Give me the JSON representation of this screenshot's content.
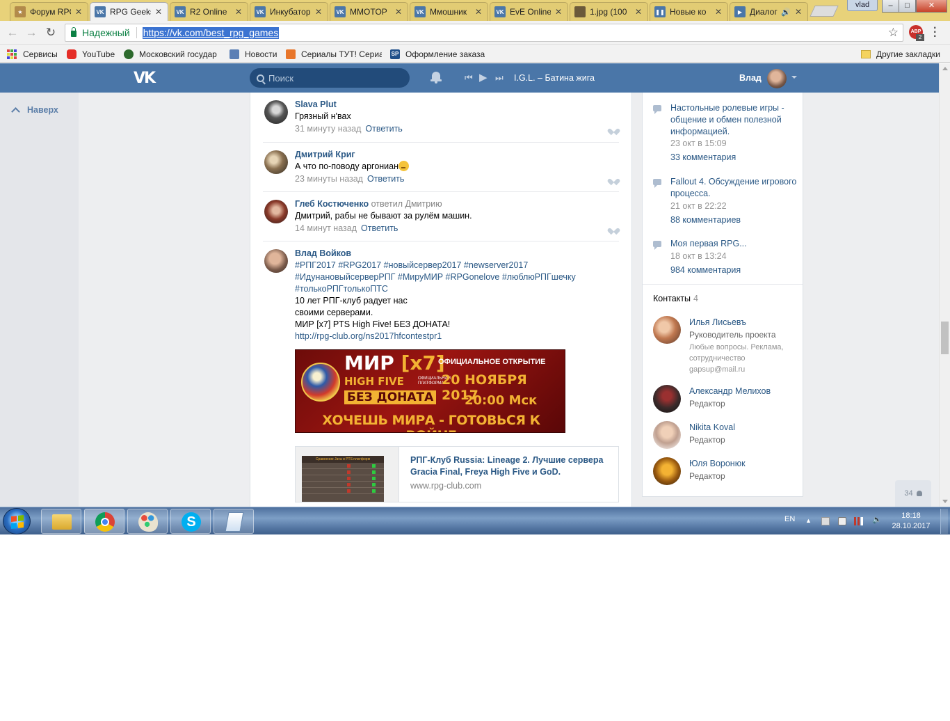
{
  "browser": {
    "window_user": "vlad",
    "tabs": [
      {
        "title": "Форум RPG",
        "icon": "forum-icon",
        "color": "#b28a4a"
      },
      {
        "title": "RPG Geeks",
        "icon": "vk-icon",
        "color": "#4a76a8",
        "active": true
      },
      {
        "title": "R2 Online",
        "icon": "vk-icon",
        "color": "#4a76a8"
      },
      {
        "title": "Инкубатор",
        "icon": "vk-icon",
        "color": "#4a76a8"
      },
      {
        "title": "MMOTOP",
        "icon": "vk-icon",
        "color": "#4a76a8"
      },
      {
        "title": "Ммошник",
        "icon": "vk-icon",
        "color": "#4a76a8"
      },
      {
        "title": "EvE Online",
        "icon": "vk-icon",
        "color": "#4a76a8"
      },
      {
        "title": "1.jpg (100",
        "icon": "image-icon",
        "color": "#6b5a3a"
      },
      {
        "title": "Новые ко",
        "icon": "pause-icon",
        "color": "#4a76a8"
      },
      {
        "title": "Диалог",
        "icon": "vk-video-icon",
        "color": "#4a76a8",
        "audio": true
      }
    ],
    "secure_label": "Надежный",
    "url": "https://vk.com/best_rpg_games",
    "abp_label": "ABP",
    "abp_count": "2",
    "bookmarks": [
      {
        "label": "Сервисы",
        "icon": "apps-icon"
      },
      {
        "label": "YouTube",
        "icon": "youtube-icon",
        "color": "#e52d27"
      },
      {
        "label": "Московский государ",
        "icon": "crest-icon",
        "color": "#2d6a2d"
      },
      {
        "label": "Новости",
        "icon": "news-icon",
        "color": "#5b7fb5"
      },
      {
        "label": "Сериалы ТУТ! Сериа",
        "icon": "serials-icon",
        "color": "#e8762b"
      },
      {
        "label": "Оформление заказа",
        "icon": "sp-icon",
        "color": "#1f4f8a",
        "text": "SP"
      }
    ],
    "other_bookmarks": "Другие закладки"
  },
  "vk": {
    "search_placeholder": "Поиск",
    "now_playing": "I.G.L. – Батина жига",
    "user_name": "Влад",
    "back_to_top": "Наверх",
    "comments": [
      {
        "author": "Slava Plut",
        "text": "Грязный н'вах",
        "time": "31 минуту назад",
        "reply": "Ответить"
      },
      {
        "author": "Дмитрий Криг",
        "text": "А что по-поводу аргониан",
        "time": "23 минуты назад",
        "reply": "Ответить"
      },
      {
        "author": "Глеб Костюченко",
        "reply_to": "ответил Дмитрию",
        "text": "Дмитрий, рабы не бывают за рулём машин.",
        "time": "14 минут назад",
        "reply": "Ответить"
      }
    ],
    "post": {
      "author": "Влад Войков",
      "tags_line1": "#РПГ2017 #RPG2017 #новыйсервер2017 #newserver2017",
      "tags_line2": "#ИдунановыйсерверРПГ #МируМИР #RPGonelove #люблюРПГшечку",
      "tags_line3": "#толькоРПГтолькоПТС",
      "text_line1": "10 лет РПГ-клуб радует нас",
      "text_line2": "своими серверами.",
      "text_line3": "МИР [x7] PTS High Five! БЕЗ ДОНАТА!",
      "link": "http://rpg-club.org/ns2017hfcontestpr1",
      "banner": {
        "mir": "МИР",
        "x7": "[x7]",
        "high_five": "HIGH FIVE",
        "platform": "ОФИЦИАЛЬНАЯ ПЛАТФОРМА",
        "no_donate": "БЕЗ ДОНАТА",
        "official_open": "ОФИЦИАЛЬНОЕ ОТКРЫТИЕ",
        "date": "20 НОЯБРЯ 2017",
        "time": "20:00 Мск",
        "slogan": "ХОЧЕШЬ МИРА - ГОТОВЬСЯ К ВОЙНЕ"
      },
      "link_card": {
        "title": "РПГ-Клуб Russia: Lineage 2. Лучшие сервера Gracia Final, Freya High Five и GoD. Официальн...",
        "domain": "www.rpg-club.com",
        "thumb_header": "Сравнение Java и PTS платформ"
      }
    },
    "discussions": [
      {
        "title": "Настольные ролевые игры - общение и обмен полезной информацией.",
        "date": "23 окт в 15:09",
        "comments": "33 комментария"
      },
      {
        "title": "Fallout 4. Обсуждение игрового процесса.",
        "date": "21 окт в 22:22",
        "comments": "88 комментариев"
      },
      {
        "title": "Моя первая RPG...",
        "date": "18 окт в 13:24",
        "comments": "984 комментария"
      }
    ],
    "contacts_label": "Контакты",
    "contacts_count": "4",
    "contacts": [
      {
        "name": "Илья Лисьевъ",
        "role": "Руководитель проекта",
        "extra": "Любые вопросы. Реклама, сотрудничество gapsup@mail.ru"
      },
      {
        "name": "Александр Мелихов",
        "role": "Редактор"
      },
      {
        "name": "Nikita Koval",
        "role": "Редактор"
      },
      {
        "name": "Юля Воронюк",
        "role": "Редактор"
      }
    ],
    "online_count": "34"
  },
  "taskbar": {
    "lang": "EN",
    "time": "18:18",
    "date": "28.10.2017"
  }
}
